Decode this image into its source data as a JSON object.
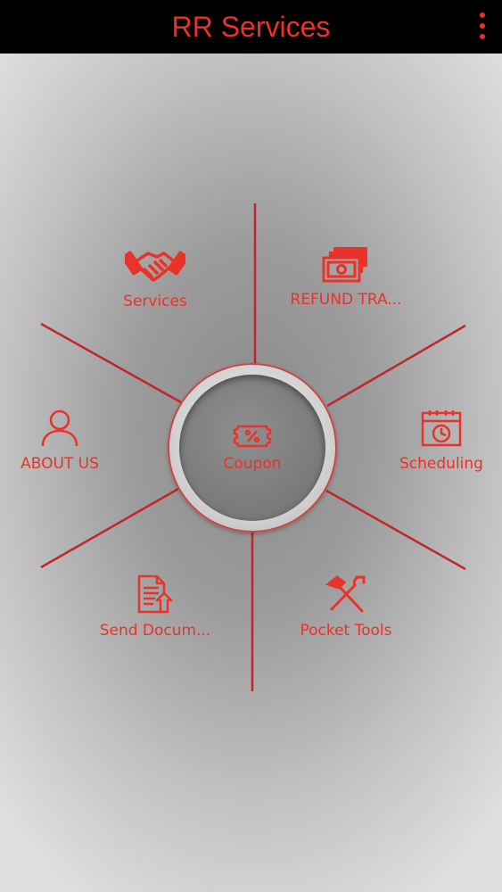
{
  "app": {
    "title": "RR Services",
    "accent_color": "#e8322a",
    "topbar_color": "#000000",
    "overflow_icon": "more-vert-icon"
  },
  "menu": {
    "items": [
      {
        "id": "services",
        "label": "Services",
        "icon": "handshake-icon"
      },
      {
        "id": "refund",
        "label": "REFUND TRA...",
        "icon": "money-stack-icon"
      },
      {
        "id": "about",
        "label": "ABOUT US",
        "icon": "person-icon"
      },
      {
        "id": "scheduling",
        "label": "Scheduling",
        "icon": "calendar-clock-icon"
      },
      {
        "id": "send-documents",
        "label": "Send Docum...",
        "icon": "document-upload-icon"
      },
      {
        "id": "pocket-tools",
        "label": "Pocket Tools",
        "icon": "tools-icon"
      }
    ],
    "center": {
      "id": "coupon",
      "label": "Coupon",
      "icon": "coupon-percent-icon"
    }
  }
}
